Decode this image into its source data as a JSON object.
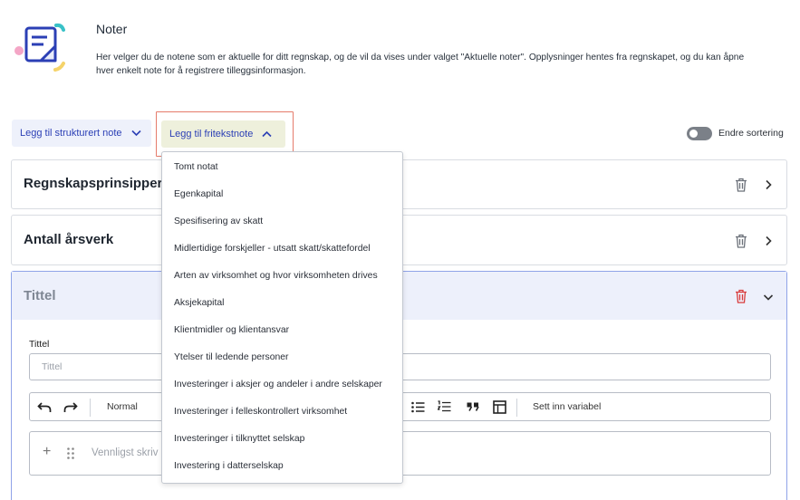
{
  "header": {
    "title": "Noter",
    "description_line1": "Her velger du de notene som er aktuelle for ditt regnskap, og de vil da vises under valget \"Aktuelle noter\". Opplysninger hentes fra regnskapet, og du kan åpne",
    "description_line2": "hver enkelt note for å registrere tilleggsinformasjon."
  },
  "actions": {
    "structured_label": "Legg til strukturert note",
    "freetext_label": "Legg til fritekstnote",
    "sort_toggle_label": "Endre sortering"
  },
  "notes": [
    {
      "title": "Regnskapsprinsipper"
    },
    {
      "title": "Antall årsverk"
    },
    {
      "title": "Tittel"
    }
  ],
  "editor": {
    "field_label": "Tittel",
    "title_placeholder": "Tittel",
    "style_label": "Normal",
    "insert_variable_label": "Sett inn variabel",
    "body_placeholder": "Vennligst skriv"
  },
  "dropdown": {
    "items": [
      "Tomt notat",
      "Egenkapital",
      "Spesifisering av skatt",
      "Midlertidige forskjeller - utsatt skatt/skattefordel",
      "Arten av virksomhet og hvor virksomheten drives",
      "Aksjekapital",
      "Klientmidler og klientansvar",
      "Ytelser til ledende personer",
      "Investeringer i aksjer og andeler i andre selskaper",
      "Investeringer i felleskontrollert virksomhet",
      "Investeringer i tilknyttet selskap",
      "Investering i datterselskap"
    ]
  },
  "colors": {
    "accent": "#2b3fb5",
    "highlight_border": "#e57b6b",
    "delete_active": "#d93b3b"
  },
  "icons": [
    "notes-illustration",
    "chevron-down-icon",
    "chevron-up-icon",
    "trash-icon",
    "chevron-right-icon",
    "undo-icon",
    "redo-icon",
    "bullet-list-icon",
    "numbered-list-icon",
    "quote-icon",
    "table-icon",
    "plus-icon",
    "drag-handle-icon"
  ]
}
